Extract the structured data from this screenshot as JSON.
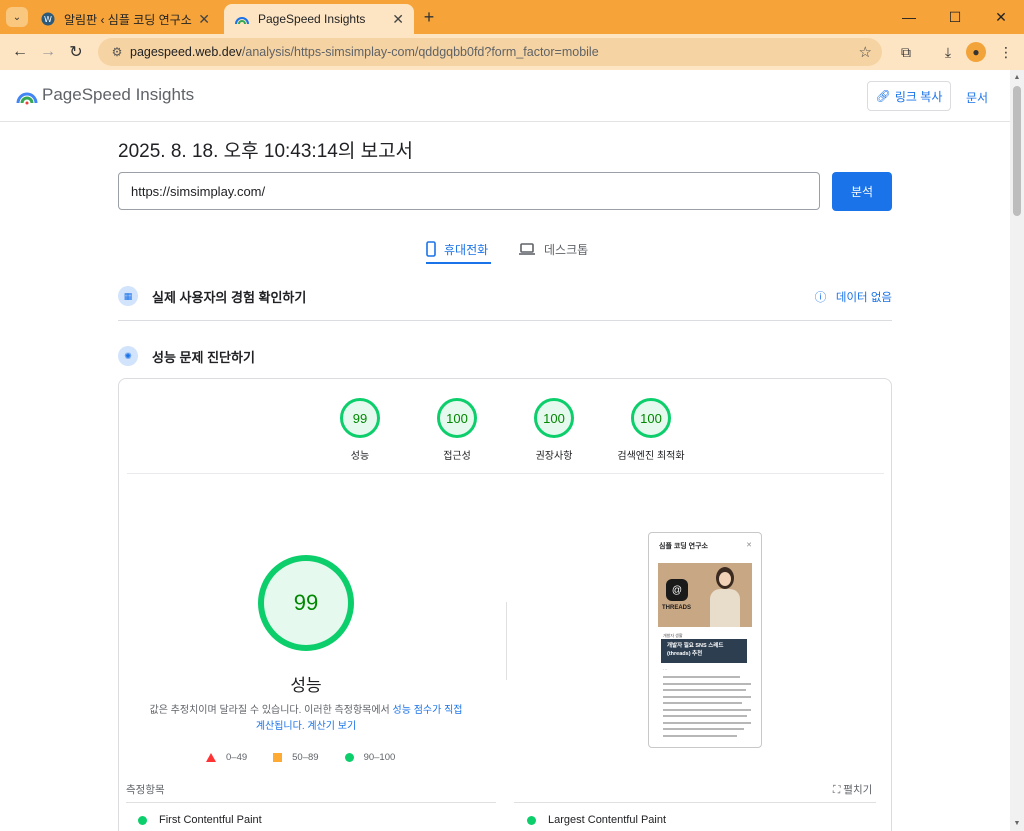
{
  "browser": {
    "tabs": [
      {
        "title": "알림판 ‹ 심플 코딩 연구소 — WordPress",
        "favicon": "wordpress-icon",
        "active": false
      },
      {
        "title": "PageSpeed Insights",
        "favicon": "pagespeed-icon",
        "active": true
      }
    ],
    "url_host": "pagespeed.web.dev",
    "url_path": "/analysis/https-simsimplay-com/qddgqbb0fd?form_factor=mobile"
  },
  "header": {
    "brand": "PageSpeed Insights",
    "copy_link": "링크 복사",
    "docs": "문서"
  },
  "report": {
    "title": "2025. 8. 18. 오후 10:43:14의 보고서",
    "url_value": "https://simsimplay.com/",
    "analyze_label": "분석"
  },
  "device_tabs": {
    "mobile": "휴대전화",
    "desktop": "데스크톱",
    "selected": "mobile"
  },
  "field_data": {
    "title": "실제 사용자의 경험 확인하기",
    "no_data": "데이터 없음"
  },
  "diagnose": {
    "title": "성능 문제 진단하기"
  },
  "scores": [
    {
      "label": "성능",
      "value": "99"
    },
    {
      "label": "접근성",
      "value": "100"
    },
    {
      "label": "권장사항",
      "value": "100"
    },
    {
      "label": "검색엔진 최적화",
      "value": "100"
    }
  ],
  "performance": {
    "score": "99",
    "label": "성능",
    "desc_prefix": "값은 추정치이며 달라질 수 있습니다. 이러한 측정항목에서 ",
    "desc_link": "성능 점수가 직접 계산됩니다.",
    "desc_calc": "계산기 보기"
  },
  "legend": [
    "0–49",
    "50–89",
    "90–100"
  ],
  "colors": {
    "pass": "#0cce6b",
    "average": "#ffaa33",
    "fail": "#ff3333",
    "accent": "#1a73e8"
  },
  "screenshot": {
    "site_title": "심플 코딩 연구소",
    "logo_text": "THREADS",
    "category": "개발자 생활",
    "post_title": "개발자 필요 SNS 스레드(threads) 추천"
  },
  "metrics": {
    "heading": "측정항목",
    "expand": "펼치기",
    "items": [
      {
        "name": "First Contentful Paint",
        "status": "pass"
      },
      {
        "name": "Largest Contentful Paint",
        "status": "pass"
      }
    ]
  }
}
